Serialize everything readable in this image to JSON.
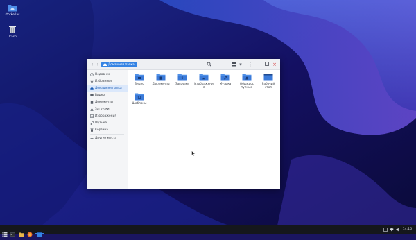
{
  "desktop": {
    "icons": [
      {
        "label": "rtorkellas",
        "icon": "home-folder-icon"
      },
      {
        "label": "Trash",
        "icon": "trash-icon"
      }
    ]
  },
  "window": {
    "breadcrumb": "Домашняя папка",
    "sidebar": [
      {
        "label": "Недавние",
        "icon": "clock-icon"
      },
      {
        "label": "Избранные",
        "icon": "star-icon"
      },
      {
        "label": "Домашняя папка",
        "icon": "home-icon",
        "active": true
      },
      {
        "label": "Видео",
        "icon": "video-icon"
      },
      {
        "label": "Документы",
        "icon": "document-icon"
      },
      {
        "label": "Загрузки",
        "icon": "download-icon"
      },
      {
        "label": "Изображения",
        "icon": "image-icon"
      },
      {
        "label": "Музыка",
        "icon": "music-icon"
      },
      {
        "label": "Корзина",
        "icon": "trash-icon"
      },
      {
        "label": "Другие места",
        "icon": "plus-icon"
      }
    ],
    "folders": [
      {
        "label": "Видео",
        "glyph": "video"
      },
      {
        "label": "Документы",
        "glyph": "document"
      },
      {
        "label": "Загрузки",
        "glyph": "download"
      },
      {
        "label": "Изображени\nя",
        "glyph": "image"
      },
      {
        "label": "Музыка",
        "glyph": "music"
      },
      {
        "label": "Общедоступные",
        "glyph": "share"
      },
      {
        "label": "Рабочий\nстол",
        "glyph": "desktop"
      },
      {
        "label": "Шаблоны",
        "glyph": "template"
      }
    ]
  },
  "taskbar": {
    "clock": "14:16",
    "accent": "#3584e4"
  }
}
